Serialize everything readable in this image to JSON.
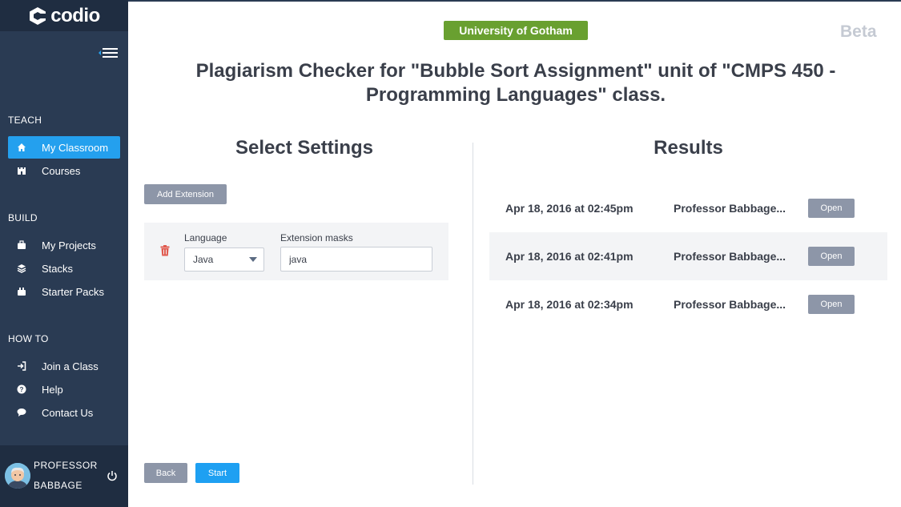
{
  "app": {
    "name": "codio"
  },
  "sidebar": {
    "sections": [
      {
        "title": "TEACH",
        "items": [
          {
            "label": "My Classroom",
            "icon": "home-icon",
            "active": true
          },
          {
            "label": "Courses",
            "icon": "castle-icon"
          }
        ]
      },
      {
        "title": "BUILD",
        "items": [
          {
            "label": "My Projects",
            "icon": "briefcase-icon"
          },
          {
            "label": "Stacks",
            "icon": "layers-icon"
          },
          {
            "label": "Starter Packs",
            "icon": "package-icon"
          }
        ]
      },
      {
        "title": "HOW TO",
        "items": [
          {
            "label": "Join a Class",
            "icon": "sign-in-icon"
          },
          {
            "label": "Help",
            "icon": "question-icon"
          },
          {
            "label": "Contact Us",
            "icon": "chat-icon"
          }
        ]
      }
    ],
    "user": {
      "first": "PROFESSOR",
      "last": "BABBAGE"
    }
  },
  "header": {
    "university": "University of Gotham",
    "beta": "Beta",
    "title": "Plagiarism Checker for \"Bubble Sort Assignment\" unit of \"CMPS 450 - Programming Languages\" class."
  },
  "settings": {
    "title": "Select Settings",
    "add_extension_label": "Add Extension",
    "language_label": "Language",
    "language_value": "Java",
    "extension_masks_label": "Extension masks",
    "extension_masks_value": "java",
    "back_label": "Back",
    "start_label": "Start"
  },
  "results": {
    "title": "Results",
    "rows": [
      {
        "date": "Apr 18, 2016 at 02:45pm",
        "author": "Professor Babbage...",
        "action": "Open"
      },
      {
        "date": "Apr 18, 2016 at 02:41pm",
        "author": "Professor Babbage...",
        "action": "Open"
      },
      {
        "date": "Apr 18, 2016 at 02:34pm",
        "author": "Professor Babbage...",
        "action": "Open"
      }
    ]
  },
  "colors": {
    "sidebar": "#2a3b53",
    "active": "#24a0ee",
    "badge": "#69a030",
    "button_gray": "#8d96a8",
    "button_blue": "#1ea0f2"
  }
}
